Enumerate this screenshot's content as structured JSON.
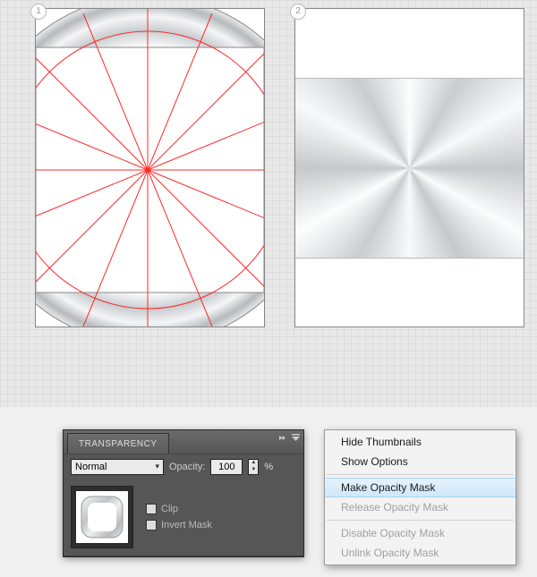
{
  "artboards": {
    "one": "1",
    "two": "2"
  },
  "panel": {
    "title": "TRANSPARENCY",
    "blend_mode": "Normal",
    "opacity_label": "Opacity:",
    "opacity_value": "100",
    "opacity_suffix": "%",
    "clip_label": "Clip",
    "invert_label": "Invert Mask"
  },
  "menu": {
    "hide_thumbnails": "Hide Thumbnails",
    "show_options": "Show Options",
    "make_opacity_mask": "Make Opacity Mask",
    "release_opacity_mask": "Release Opacity Mask",
    "disable_opacity_mask": "Disable Opacity Mask",
    "unlink_opacity_mask": "Unlink Opacity Mask"
  }
}
